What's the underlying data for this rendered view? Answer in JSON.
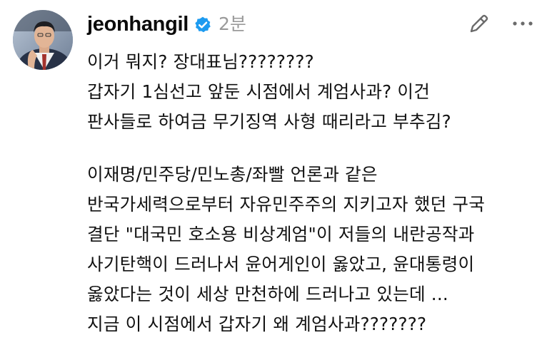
{
  "post": {
    "username": "jeonhangil",
    "verified": true,
    "timestamp": "2분",
    "avatar_icon": "user-avatar-photo",
    "edit_icon": "pencil-icon",
    "more_icon": "more-horizontal-icon",
    "paragraphs": [
      [
        "이거 뭐지? 장대표님????????",
        "갑자기 1심선고 앞둔 시점에서 계엄사과? 이건",
        "판사들로 하여금 무기징역 사형 때리라고 부추김?"
      ],
      [
        "이재명/민주당/민노총/좌빨 언론과 같은",
        "반국가세력으로부터 자유민주주의 지키고자 했던 구국",
        "결단 \"대국민 호소용 비상계엄\"이 저들의 내란공작과",
        "사기탄핵이 드러나서 윤어게인이 옳았고, 윤대통령이",
        "옳았다는 것이 세상 만천하에 드러나고 있는데 ...",
        "지금 이 시점에서 갑자기 왜 계엄사과???????"
      ]
    ]
  },
  "colors": {
    "verified_badge": "#1d9bf0",
    "timestamp": "#9a9a9a",
    "text": "#111111",
    "icon": "#6b6b6b"
  }
}
